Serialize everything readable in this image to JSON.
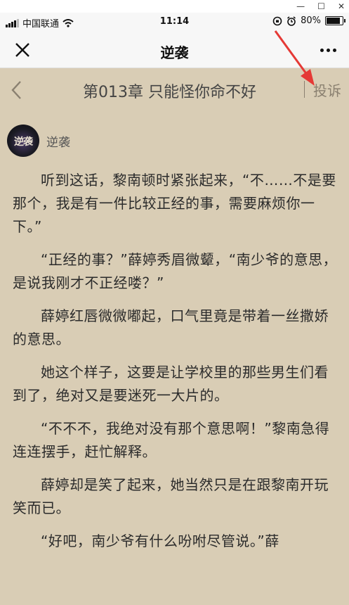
{
  "status_bar": {
    "carrier": "中国联通",
    "time": "11:14",
    "battery": "80%",
    "battery_level": 0.8
  },
  "nav": {
    "title": "逆袭"
  },
  "chapter": {
    "title": "第013章 只能怪你命不好",
    "complaint": "投诉"
  },
  "author": {
    "name": "逆袭",
    "avatar_text": "逆袭"
  },
  "paragraphs": [
    "听到这话，黎南顿时紧张起来，“不……不是要那个，我是有一件比较正经的事，需要麻烦你一下。”",
    "“正经的事？”薛婷秀眉微颦，“南少爷的意思，是说我刚才不正经喽？”",
    "薛婷红唇微微嘟起，口气里竟是带着一丝撒娇的意思。",
    "她这个样子，这要是让学校里的那些男生们看到了，绝对又是要迷死一大片的。",
    "“不不不，我绝对没有那个意思啊！”黎南急得连连摆手，赶忙解释。",
    "薛婷却是笑了起来，她当然只是在跟黎南开玩笑而已。",
    "“好吧，南少爷有什么吩咐尽管说。”薛"
  ],
  "colors": {
    "page_bg": "#d9cdb5",
    "text": "#2b2b2b",
    "annotation_arrow": "#e53935"
  }
}
